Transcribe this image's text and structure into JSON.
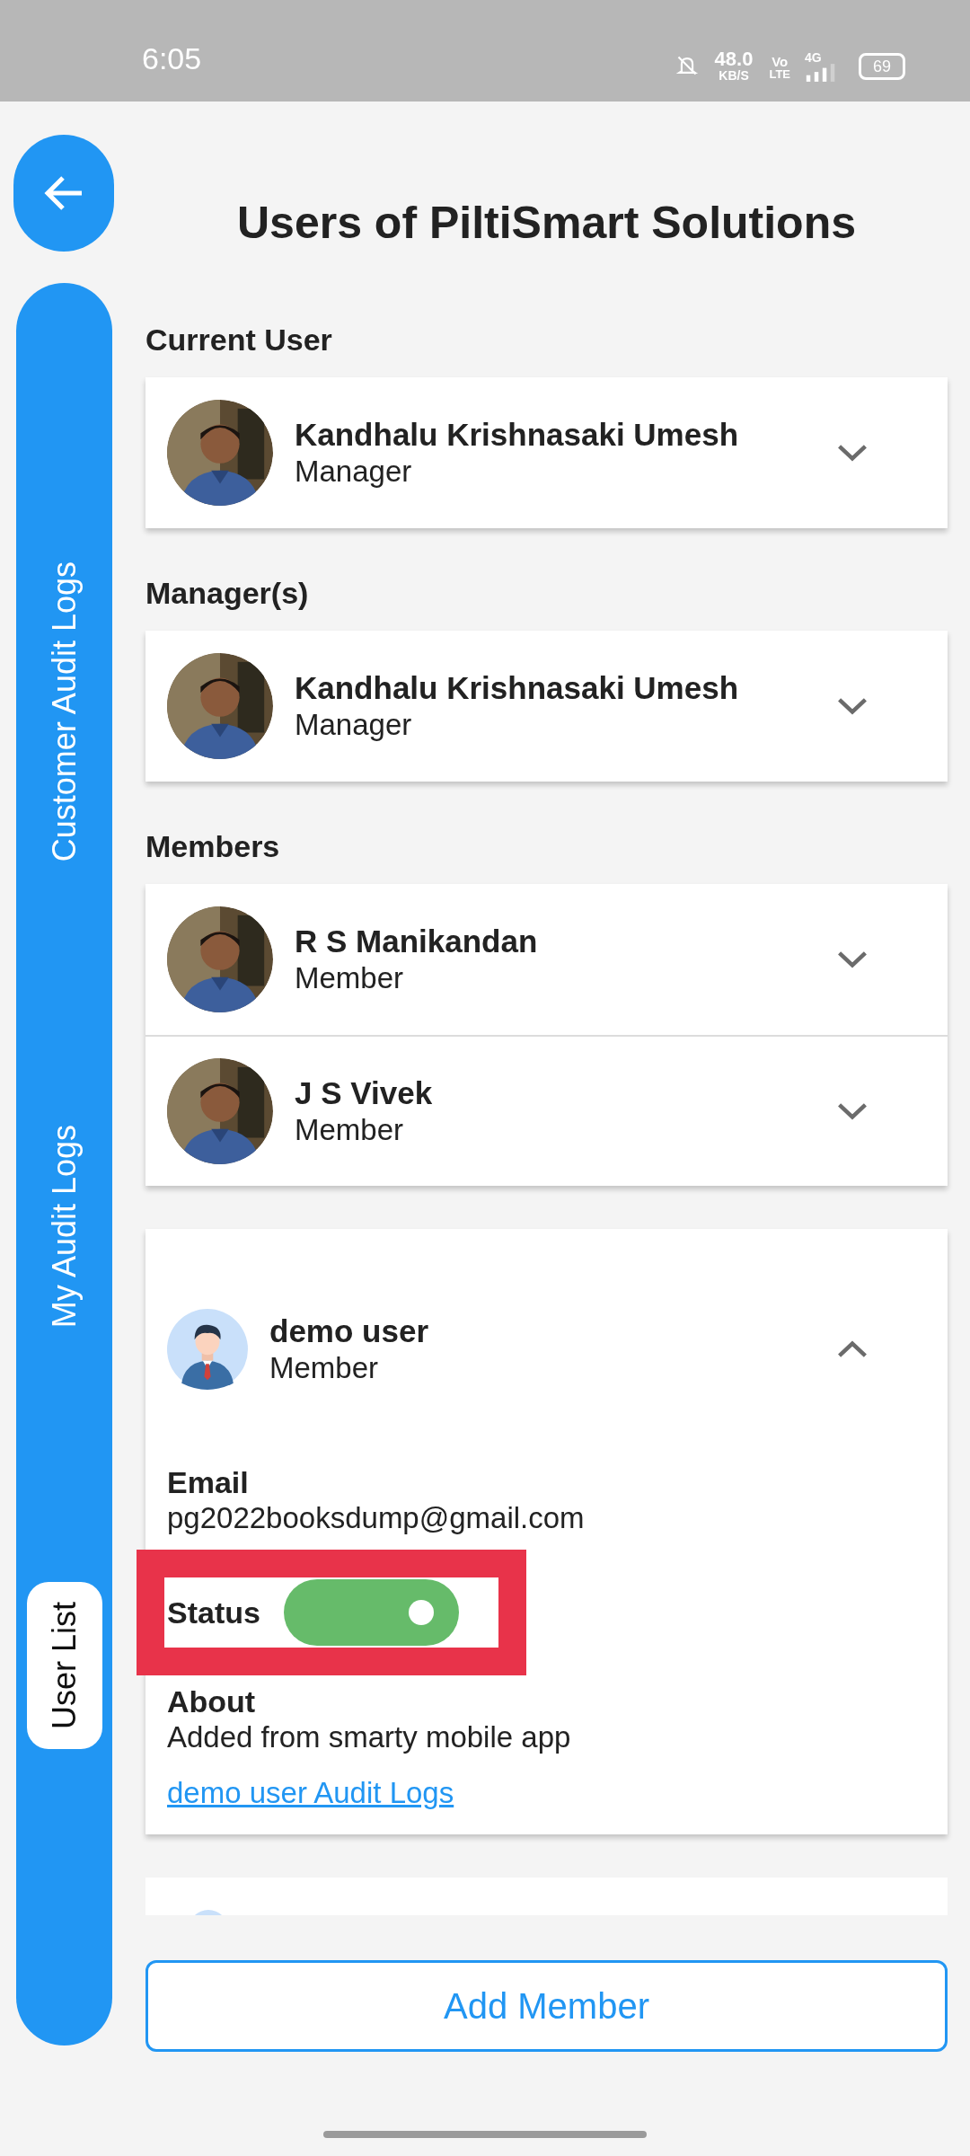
{
  "status_bar": {
    "time": "6:05",
    "speed": "48.0",
    "speed_unit": "KB/S",
    "volte_top": "Vo",
    "volte_bottom": "LTE",
    "network": "4G",
    "battery": "69"
  },
  "sidebar": {
    "items": [
      {
        "label": "Customer Audit Logs",
        "selected": false
      },
      {
        "label": "My Audit Logs",
        "selected": false
      },
      {
        "label": "User List",
        "selected": true
      }
    ]
  },
  "title": "Users of PiltiSmart Solutions",
  "sections": [
    {
      "heading": "Current User",
      "users": [
        {
          "name": "Kandhalu Krishnasaki Umesh",
          "role": "Manager",
          "expanded": false
        }
      ]
    },
    {
      "heading": "Manager(s)",
      "users": [
        {
          "name": "Kandhalu Krishnasaki Umesh",
          "role": "Manager",
          "expanded": false
        }
      ]
    },
    {
      "heading": "Members",
      "users": [
        {
          "name": "R S Manikandan",
          "role": "Member",
          "expanded": false
        },
        {
          "name": "J S Vivek",
          "role": "Member",
          "expanded": false
        }
      ]
    }
  ],
  "expanded_user": {
    "name": "demo user",
    "role": "Member",
    "kind": "illustration",
    "expanded": true,
    "email_label": "Email",
    "email": "pg2022booksdump@gmail.com",
    "status_label": "Status",
    "status_on": true,
    "about_label": "About",
    "about": "Added from smarty mobile app",
    "audit_link": "demo user Audit Logs"
  },
  "add_button": "Add Member"
}
